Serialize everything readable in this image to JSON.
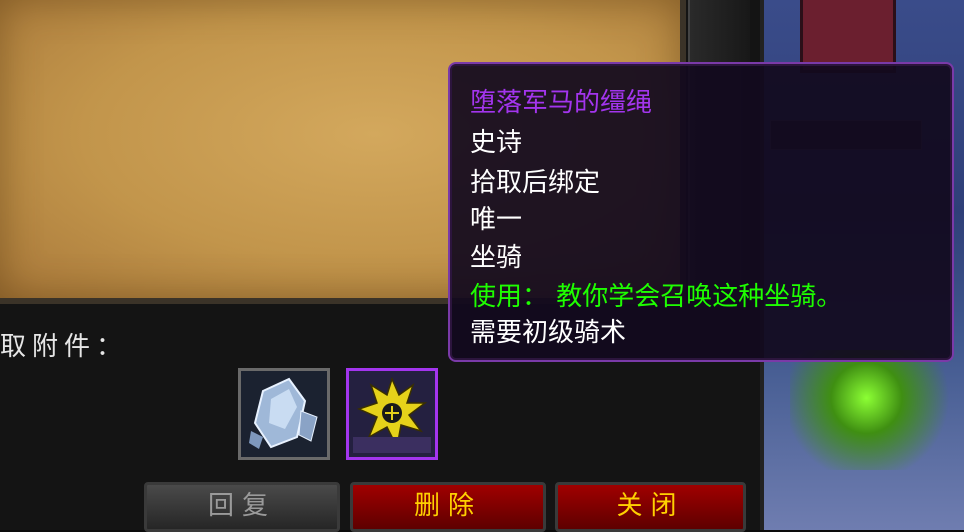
{
  "mail": {
    "attachments_label": "取附件：",
    "attachments": [
      {
        "icon": "ice-crystal-icon"
      },
      {
        "icon": "fallen-charger-reins-icon",
        "quality_color": "#a335ee"
      }
    ],
    "buttons": {
      "reply": "回复",
      "delete": "删除",
      "close": "关闭"
    }
  },
  "tooltip": {
    "item_name": "堕落军马的缰绳",
    "item_name_color": "#a335ee",
    "quality": "史诗",
    "binding": "拾取后绑定",
    "uniqueness": "唯一",
    "type": "坐骑",
    "use_text": "使用： 教你学会召唤这种坐骑。",
    "use_color": "#1eff00",
    "requirement": "需要初级骑术"
  }
}
